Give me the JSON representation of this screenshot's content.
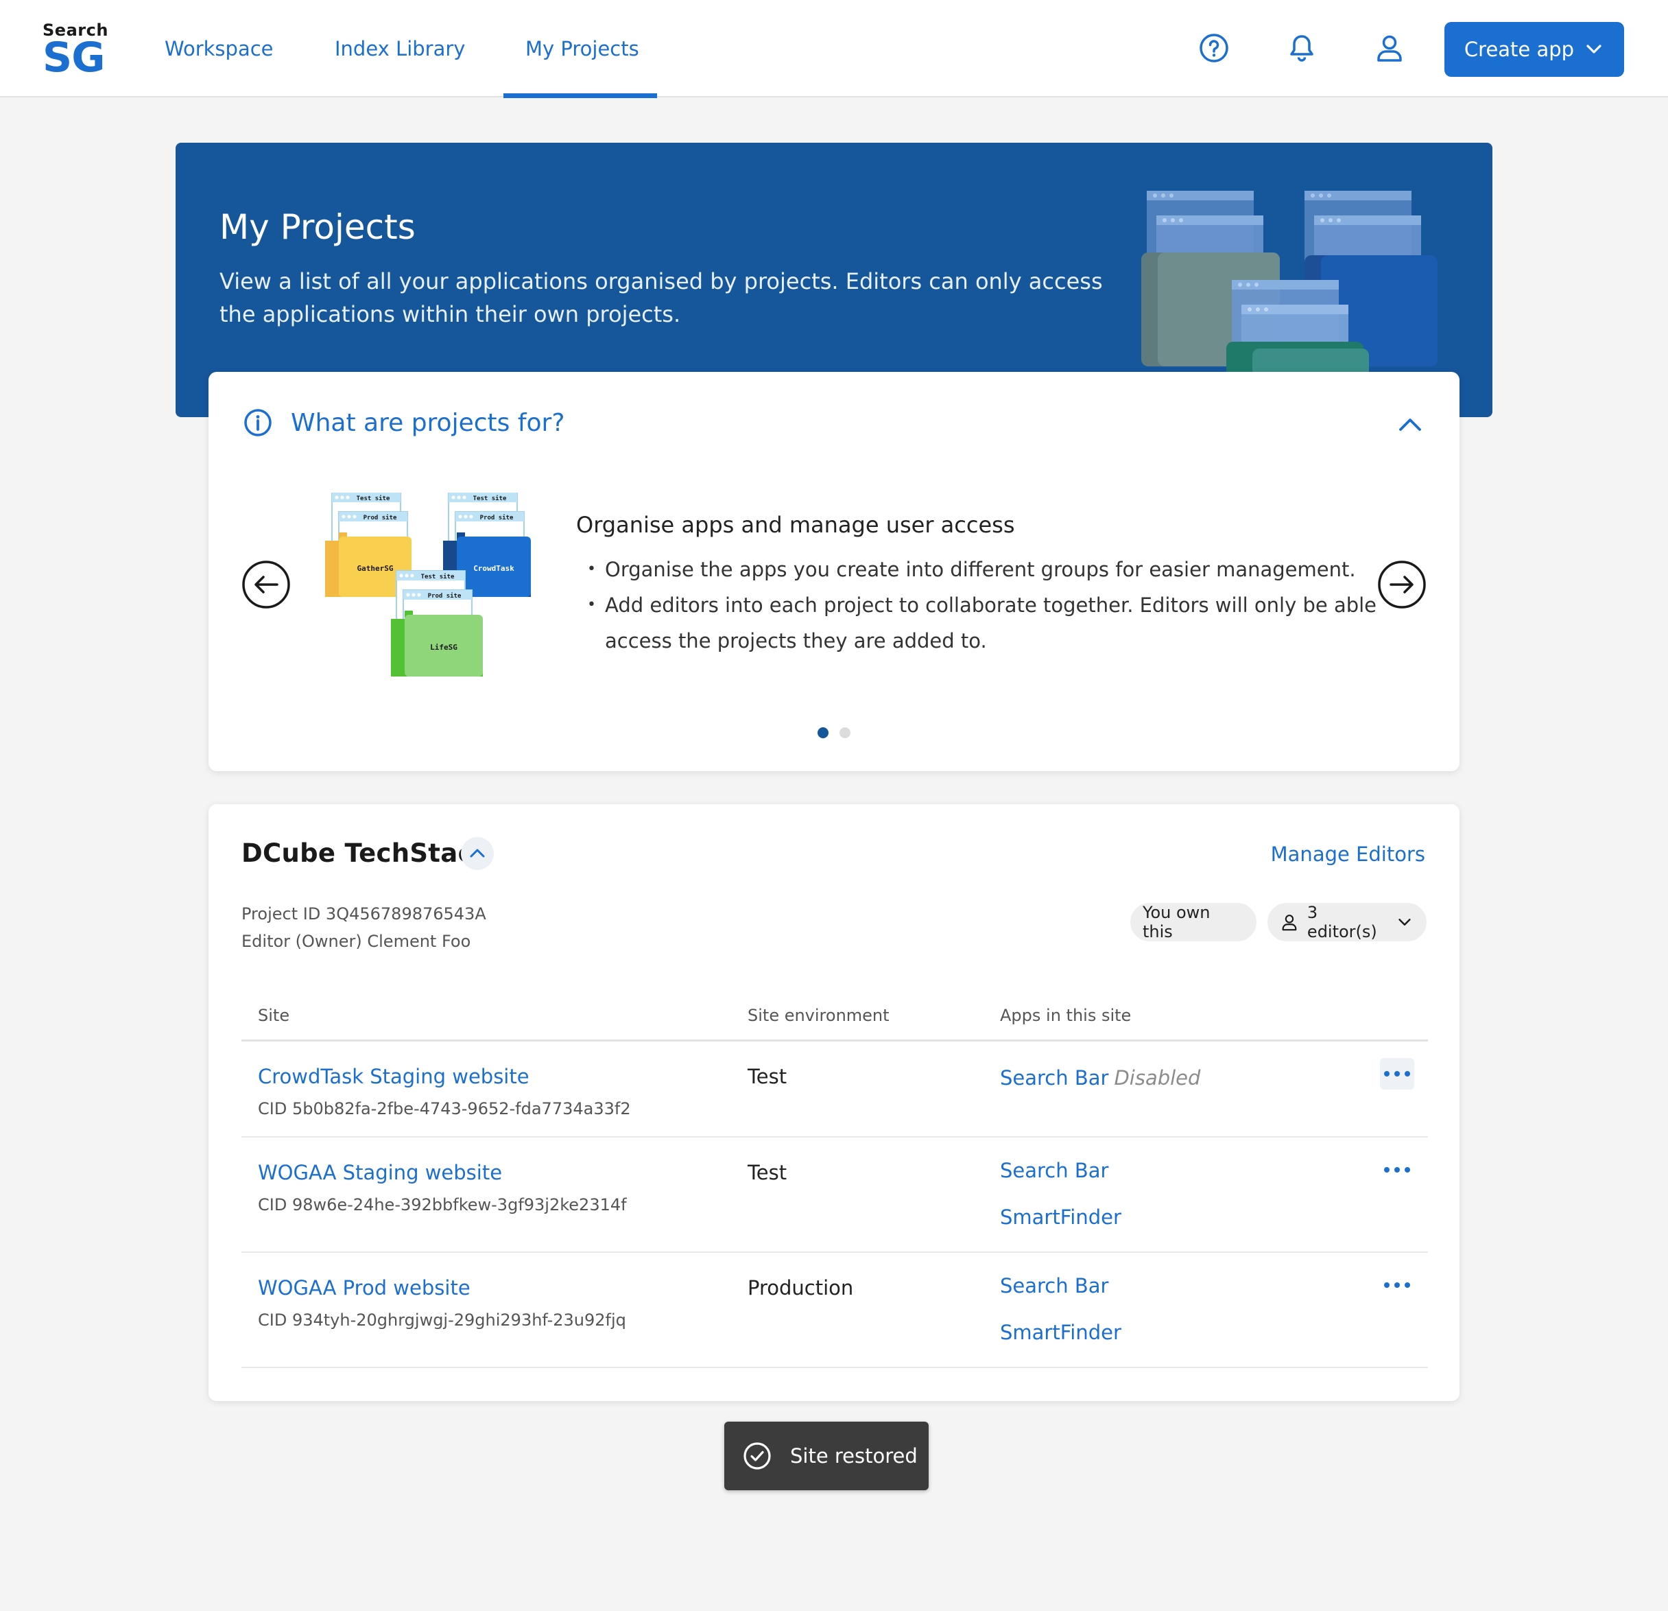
{
  "brand": {
    "top": "Search",
    "bottom": "SG",
    "color": "#1b6fd1"
  },
  "nav": {
    "items": [
      {
        "label": "Workspace"
      },
      {
        "label": "Index Library"
      },
      {
        "label": "My Projects",
        "active": true
      }
    ]
  },
  "header": {
    "icons": [
      "help-icon",
      "bell-icon",
      "user-icon"
    ],
    "create_label": "Create app"
  },
  "banner": {
    "title": "My Projects",
    "description": "View a list of all your applications organised by projects. Editors can only access the applications within their own projects."
  },
  "info": {
    "heading": "What are projects for?",
    "slide_title": "Organise apps and manage user access",
    "bullets": [
      "Organise the apps you create into different groups for easier management.",
      "Add editors into each project to collaborate together. Editors will only be able access the projects they are added to."
    ],
    "illustration": {
      "folders": [
        {
          "name": "GatherSG",
          "tab1": "Test site",
          "tab2": "Prod site",
          "color": "#f9cf4f"
        },
        {
          "name": "CrowdTask",
          "tab1": "Test site",
          "tab2": "Prod site",
          "color": "#1b6fd1"
        },
        {
          "name": "LifeSG",
          "tab1": "Test site",
          "tab2": "Prod site",
          "color": "#8fd67a"
        }
      ]
    },
    "pagination": {
      "current": 1,
      "total": 2
    }
  },
  "project": {
    "name": "DCube TechStack",
    "manage_label": "Manage Editors",
    "id_line": "Project ID 3Q456789876543A",
    "owner_line": "Editor (Owner) Clement Foo",
    "ownership_label": "You own this",
    "editors_label": "3 editor(s)",
    "columns": [
      "Site",
      "Site environment",
      "Apps in this site"
    ],
    "rows": [
      {
        "site": "CrowdTask Staging website",
        "cid": "CID 5b0b82fa-2fbe-4743-9652-fda7734a33f2",
        "env": "Test",
        "apps": [
          "Search Bar"
        ],
        "app_status": "Disabled"
      },
      {
        "site": "WOGAA Staging website",
        "cid": "CID 98w6e-24he-392bbfkew-3gf93j2ke2314f",
        "env": "Test",
        "apps": [
          "Search Bar",
          "SmartFinder"
        ]
      },
      {
        "site": "WOGAA Prod website",
        "cid": "CID 934tyh-20ghrgjwgj-29ghi293hf-23u92fjq",
        "env": "Production",
        "apps": [
          "Search Bar",
          "SmartFinder"
        ]
      }
    ]
  },
  "toast": {
    "message": "Site restored",
    "icon": "check-circle-icon"
  },
  "colors": {
    "primary": "#1b6fd1",
    "banner": "#16569b",
    "background": "#f4f4f4",
    "toast": "#3c3c3c"
  }
}
